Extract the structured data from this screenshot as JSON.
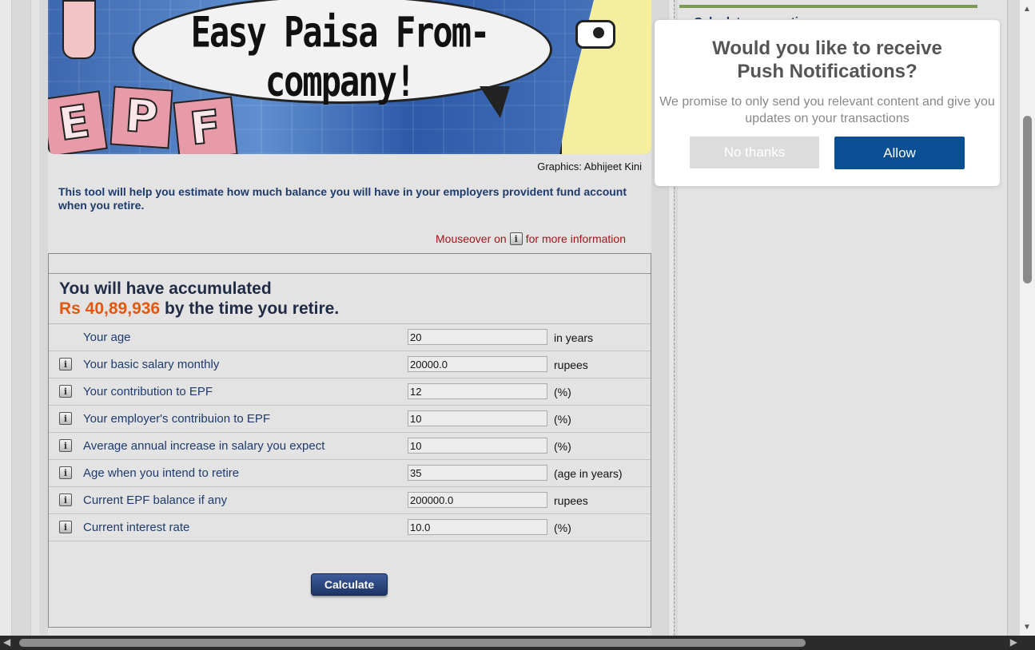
{
  "banner": {
    "headline": "Easy Paisa From-company!",
    "epf_letters": [
      "E",
      "P",
      "F"
    ],
    "credit": "Graphics: Abhijeet Kini"
  },
  "intro": "This tool will help you estimate how much balance you will have in your employers provident fund account when you retire.",
  "mouseover": {
    "before": "Mouseover on",
    "after": "for more information",
    "icon": "info-icon"
  },
  "sidebar": {
    "link_peek": "Calculate your retir..."
  },
  "result": {
    "line1": "You will have accumulated",
    "amount": "Rs 40,89,936",
    "line2_suffix": "by the time you retire."
  },
  "fields": [
    {
      "label": "Your age",
      "value": "20",
      "unit": "in years",
      "info": false
    },
    {
      "label": "Your basic salary monthly",
      "value": "20000.0",
      "unit": "rupees",
      "info": true
    },
    {
      "label": "Your contribution to EPF",
      "value": "12",
      "unit": "(%)",
      "info": true
    },
    {
      "label": "Your employer's contribuion to EPF",
      "value": "10",
      "unit": "(%)",
      "info": true
    },
    {
      "label": "Average annual increase in salary you expect",
      "value": "10",
      "unit": "(%)",
      "info": true
    },
    {
      "label": "Age when you intend to retire",
      "value": "35",
      "unit": "(age in years)",
      "info": true
    },
    {
      "label": "Current EPF balance if any",
      "value": "200000.0",
      "unit": "rupees",
      "info": true
    },
    {
      "label": "Current interest rate",
      "value": "10.0",
      "unit": "(%)",
      "info": true
    }
  ],
  "calculate_label": "Calculate",
  "popup": {
    "title_line1": "Would you like to receive",
    "title_line2": "Push Notifications?",
    "body": "We promise to only send you relevant content and give you updates on your transactions",
    "decline": "No thanks",
    "accept": "Allow",
    "colors": {
      "accept_bg": "#0a4f93",
      "decline_bg": "#dcdcdc"
    }
  },
  "colors": {
    "accent_orange": "#e4570c",
    "navy_text": "#1e3b6e",
    "hint_red": "#a3141b"
  }
}
